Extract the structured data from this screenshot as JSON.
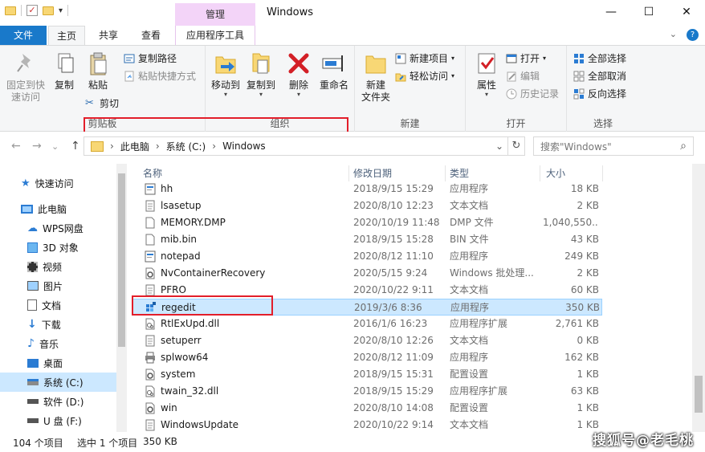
{
  "window": {
    "title": "Windows",
    "context_tab_group": "管理",
    "min_glyph": "—",
    "max_glyph": "☐",
    "close_glyph": "✕"
  },
  "tabs": {
    "file": "文件",
    "home": "主页",
    "share": "共享",
    "view": "查看",
    "app_tools": "应用程序工具",
    "expand_glyph": "⌄",
    "help_glyph": "?"
  },
  "ribbon": {
    "clipboard": {
      "label": "剪贴板",
      "pin_quick_access": "固定到快\n速访问",
      "copy": "复制",
      "paste": "粘贴",
      "copy_path": "复制路径",
      "paste_shortcut": "粘贴快捷方式",
      "cut": "剪切"
    },
    "organize": {
      "label": "组织",
      "move_to": "移动到",
      "copy_to": "复制到",
      "delete": "删除",
      "rename": "重命名"
    },
    "new": {
      "label": "新建",
      "new_folder": "新建\n文件夹",
      "new_item": "新建项目",
      "easy_access": "轻松访问"
    },
    "open": {
      "label": "打开",
      "properties": "属性",
      "open": "打开",
      "edit": "编辑",
      "history": "历史记录"
    },
    "select": {
      "label": "选择",
      "select_all": "全部选择",
      "select_none": "全部取消",
      "invert": "反向选择"
    }
  },
  "nav": {
    "back_glyph": "←",
    "forward_glyph": "→",
    "recent_glyph": "⌄",
    "up_glyph": "↑",
    "breadcrumb": [
      "此电脑",
      "系统 (C:)",
      "Windows"
    ],
    "crumb_sep": "›",
    "dropdown_glyph": "⌄",
    "refresh_glyph": "↻",
    "search_placeholder": "搜索\"Windows\"",
    "search_glyph": "⌕"
  },
  "sidebar": {
    "items": [
      {
        "label": "快速访问",
        "icon": "star-icon"
      },
      {
        "label": "此电脑",
        "icon": "computer-icon"
      },
      {
        "label": "WPS网盘",
        "icon": "cloud-icon"
      },
      {
        "label": "3D 对象",
        "icon": "cube-icon"
      },
      {
        "label": "视频",
        "icon": "film-icon"
      },
      {
        "label": "图片",
        "icon": "picture-icon"
      },
      {
        "label": "文档",
        "icon": "document-icon"
      },
      {
        "label": "下载",
        "icon": "download-icon"
      },
      {
        "label": "音乐",
        "icon": "music-icon"
      },
      {
        "label": "桌面",
        "icon": "desktop-icon"
      },
      {
        "label": "系统 (C:)",
        "icon": "drive-icon",
        "selected": true
      },
      {
        "label": "软件 (D:)",
        "icon": "drive-icon"
      },
      {
        "label": "U 盘 (F:)",
        "icon": "drive-icon"
      }
    ]
  },
  "columns": {
    "name": "名称",
    "date": "修改日期",
    "type": "类型",
    "size": "大小"
  },
  "files": [
    {
      "name": "hh",
      "date": "2018/9/15 15:29",
      "type": "应用程序",
      "size": "18 KB",
      "icon": "app"
    },
    {
      "name": "lsasetup",
      "date": "2020/8/10 12:23",
      "type": "文本文档",
      "size": "2 KB",
      "icon": "text"
    },
    {
      "name": "MEMORY.DMP",
      "date": "2020/10/19 11:48",
      "type": "DMP 文件",
      "size": "1,040,550...",
      "icon": "blank"
    },
    {
      "name": "mib.bin",
      "date": "2018/9/15 15:28",
      "type": "BIN 文件",
      "size": "43 KB",
      "icon": "blank"
    },
    {
      "name": "notepad",
      "date": "2020/8/12 11:10",
      "type": "应用程序",
      "size": "249 KB",
      "icon": "app"
    },
    {
      "name": "NvContainerRecovery",
      "date": "2020/5/15 9:24",
      "type": "Windows 批处理...",
      "size": "2 KB",
      "icon": "gear"
    },
    {
      "name": "PFRO",
      "date": "2020/10/22 9:11",
      "type": "文本文档",
      "size": "60 KB",
      "icon": "text"
    },
    {
      "name": "regedit",
      "date": "2019/3/6 8:36",
      "type": "应用程序",
      "size": "350 KB",
      "icon": "regedit",
      "selected": true
    },
    {
      "name": "RtlExUpd.dll",
      "date": "2016/1/6 16:23",
      "type": "应用程序扩展",
      "size": "2,761 KB",
      "icon": "dll"
    },
    {
      "name": "setuperr",
      "date": "2020/8/10 12:26",
      "type": "文本文档",
      "size": "0 KB",
      "icon": "text"
    },
    {
      "name": "splwow64",
      "date": "2020/8/12 11:09",
      "type": "应用程序",
      "size": "162 KB",
      "icon": "printer"
    },
    {
      "name": "system",
      "date": "2018/9/15 15:31",
      "type": "配置设置",
      "size": "1 KB",
      "icon": "gear"
    },
    {
      "name": "twain_32.dll",
      "date": "2018/9/15 15:29",
      "type": "应用程序扩展",
      "size": "63 KB",
      "icon": "dll"
    },
    {
      "name": "win",
      "date": "2020/8/10 14:08",
      "type": "配置设置",
      "size": "1 KB",
      "icon": "gear"
    },
    {
      "name": "WindowsUpdate",
      "date": "2020/10/22 9:14",
      "type": "文本文档",
      "size": "1 KB",
      "icon": "text"
    }
  ],
  "status": {
    "item_count": "104 个项目",
    "selected": "选中 1 个项目",
    "selected_size": "350 KB"
  },
  "watermark": "搜狐号@老毛桃",
  "colors": {
    "accent": "#1979ca",
    "selection": "#cce8ff",
    "highlight_box": "#e21e2a",
    "manage_tab": "#f3d4f8"
  }
}
